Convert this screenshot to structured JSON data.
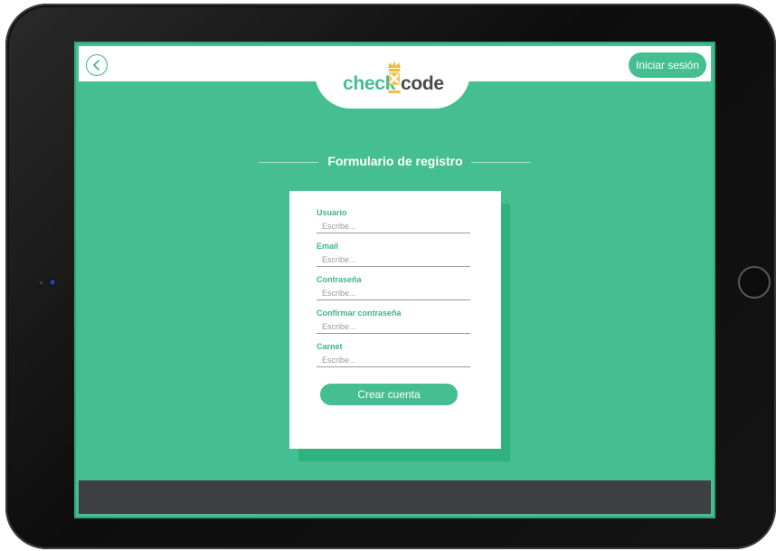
{
  "header": {
    "back_icon": "chevron-left-icon",
    "login_label": "Iniciar sesión",
    "logo": {
      "part1": "check",
      "part2": "code",
      "crown_icon": "crown-icon"
    }
  },
  "form": {
    "title": "Formulario de registro",
    "fields": [
      {
        "label": "Usuario",
        "placeholder": "Escribe..."
      },
      {
        "label": "Email",
        "placeholder": "Escribe..."
      },
      {
        "label": "Contraseña",
        "placeholder": "Escribe..."
      },
      {
        "label": "Confirmar contraseña",
        "placeholder": "Escribe..."
      },
      {
        "label": "Carnet",
        "placeholder": "Escribe..."
      }
    ],
    "submit_label": "Crear cuenta"
  },
  "colors": {
    "accent": "#45be91",
    "card_shadow": "#2fb27e",
    "footer": "#3d3f41",
    "crown": "#f4b63c"
  }
}
